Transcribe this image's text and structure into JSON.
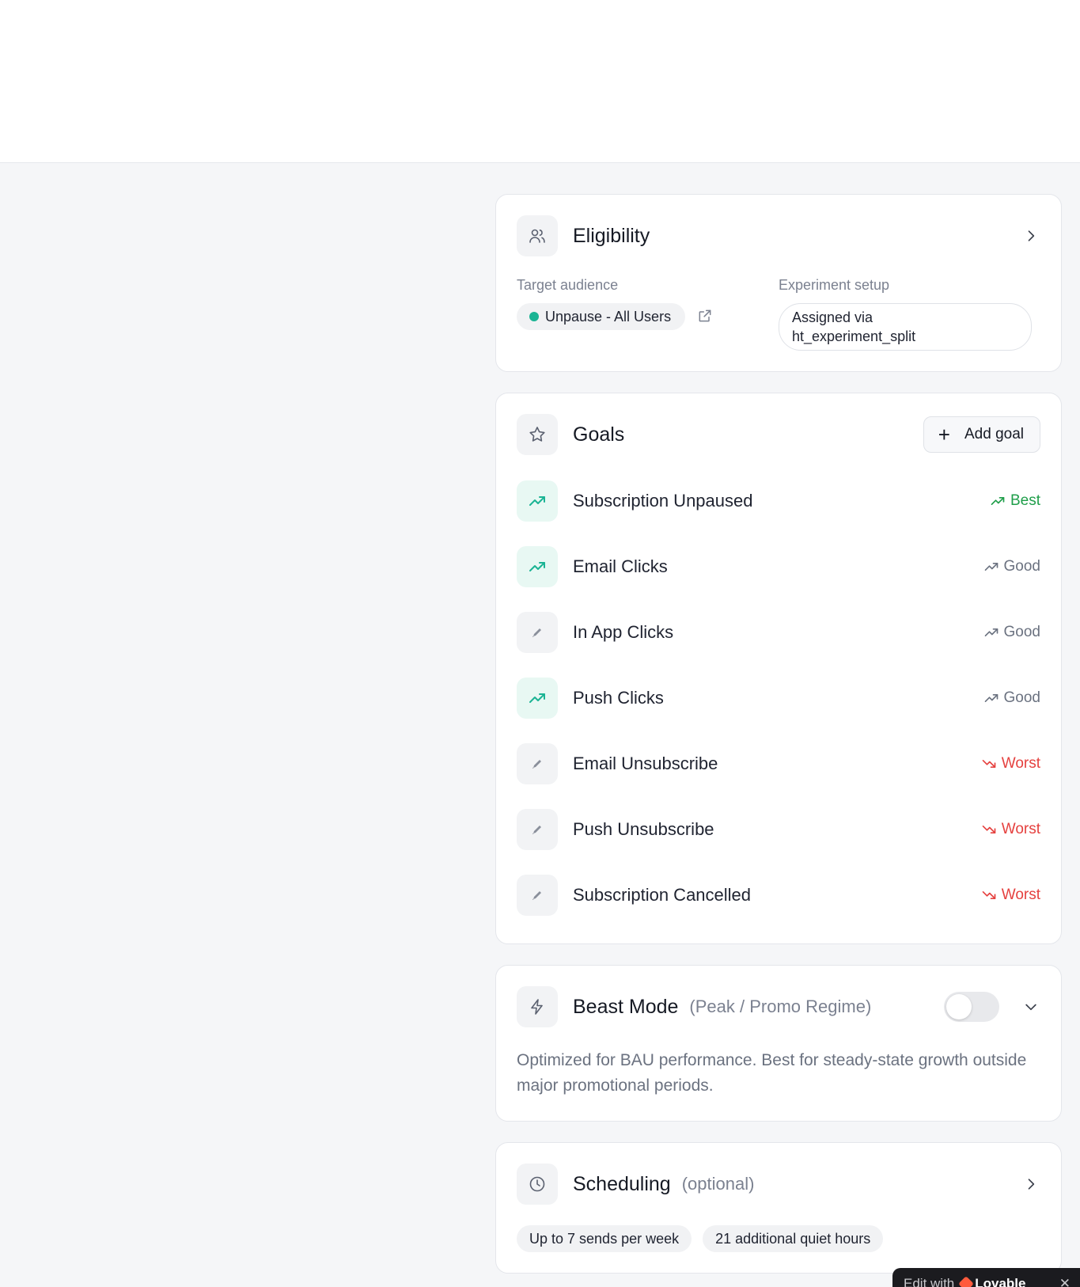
{
  "eligibility": {
    "title": "Eligibility",
    "target_label": "Target audience",
    "target_value": "Unpause - All Users",
    "setup_label": "Experiment setup",
    "setup_line1": "Assigned via",
    "setup_line2": "ht_experiment_split"
  },
  "goals": {
    "title": "Goals",
    "add_label": "Add goal",
    "items": [
      {
        "name": "Subscription Unpaused",
        "rating": "Best"
      },
      {
        "name": "Email Clicks",
        "rating": "Good"
      },
      {
        "name": "In App Clicks",
        "rating": "Good"
      },
      {
        "name": "Push Clicks",
        "rating": "Good"
      },
      {
        "name": "Email Unsubscribe",
        "rating": "Worst"
      },
      {
        "name": "Push Unsubscribe",
        "rating": "Worst"
      },
      {
        "name": "Subscription Cancelled",
        "rating": "Worst"
      }
    ]
  },
  "beast": {
    "title": "Beast Mode",
    "subtitle": "(Peak / Promo Regime)",
    "enabled": false,
    "description": "Optimized for BAU performance. Best for steady-state growth outside major promotional periods."
  },
  "scheduling": {
    "title": "Scheduling",
    "subtitle": "(optional)",
    "chips": [
      "Up to 7 sends per week",
      "21 additional quiet hours"
    ]
  },
  "badge": {
    "prefix": "Edit with",
    "brand": "Lovable",
    "close": "✕"
  },
  "colors": {
    "accent_green": "#1bb494",
    "best": "#1f9e4a",
    "good": "#6b7280",
    "worst": "#e5413f"
  }
}
